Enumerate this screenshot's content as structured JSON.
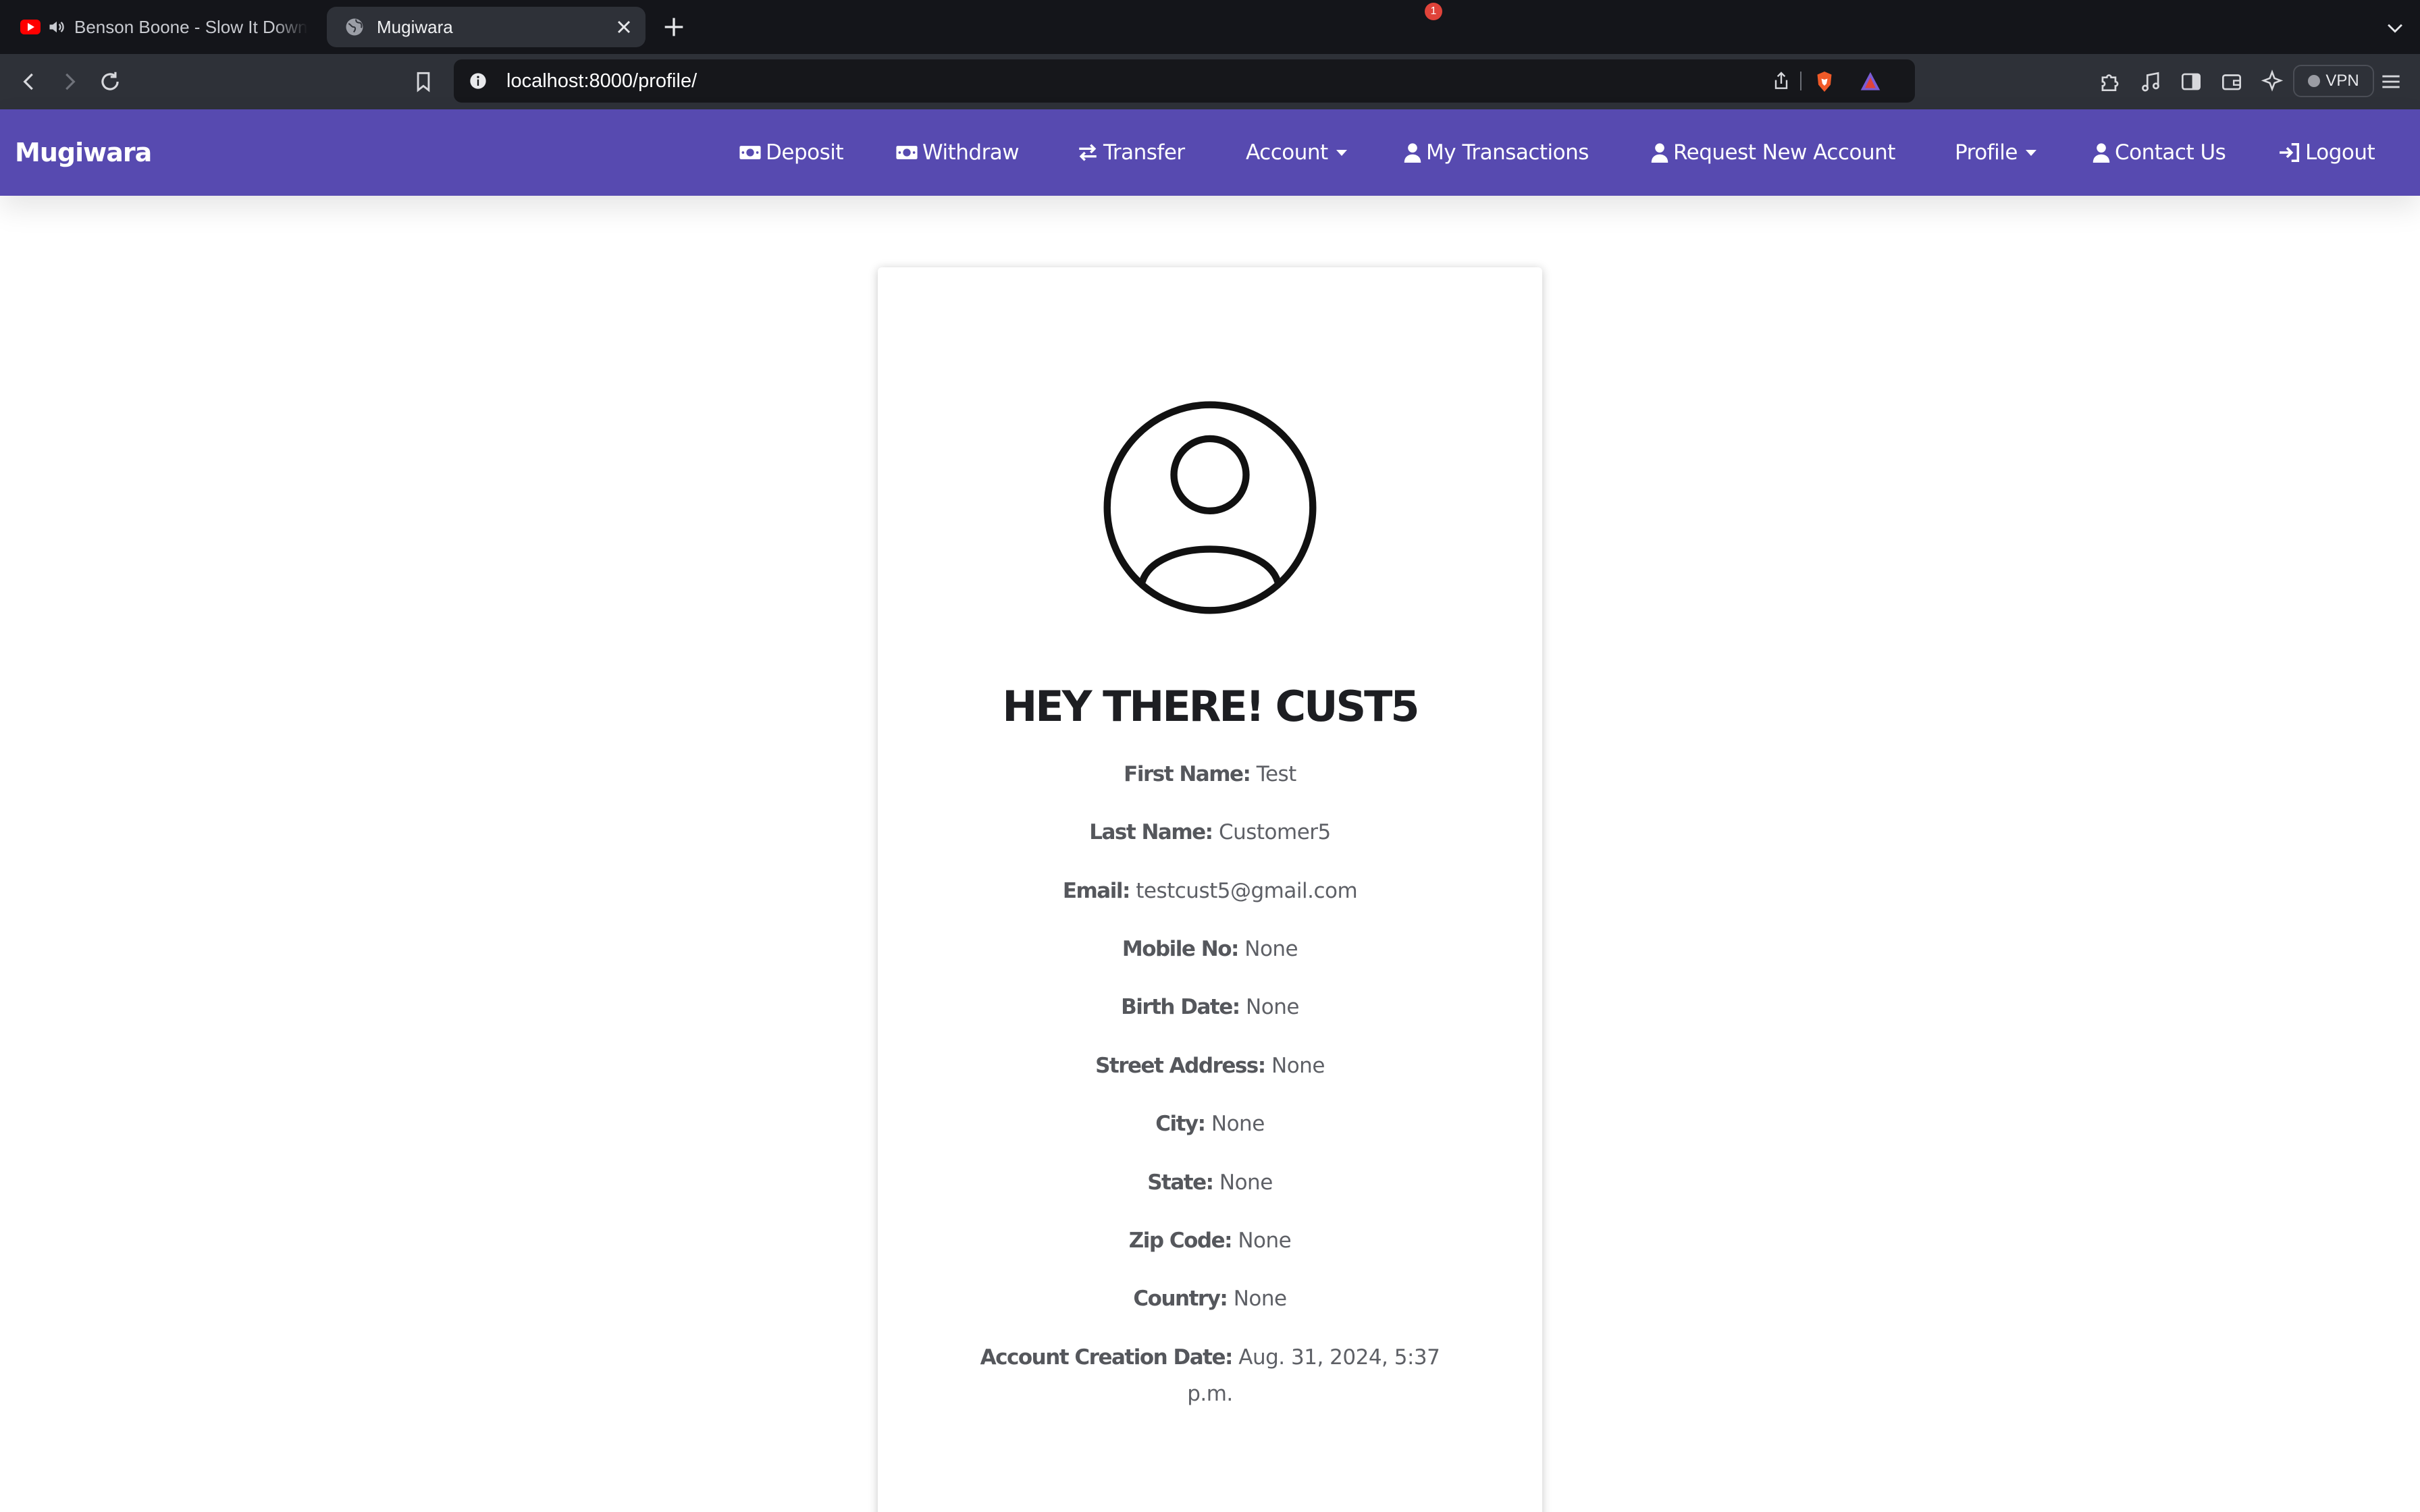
{
  "browser": {
    "tabs": [
      {
        "title": "Benson Boone - Slow It Down"
      },
      {
        "title": "Mugiwara"
      }
    ],
    "url": "localhost:8000/profile/",
    "rewards_badge": "1",
    "vpn_label": "VPN"
  },
  "navbar": {
    "brand": "Mugiwara",
    "items": [
      {
        "label": "Deposit",
        "icon": "money-bill-icon"
      },
      {
        "label": "Withdraw",
        "icon": "money-bill-icon"
      },
      {
        "label": "Transfer",
        "icon": "exchange-arrows-icon"
      },
      {
        "label": "Account",
        "dropdown": true
      },
      {
        "label": "My Transactions",
        "icon": "user-icon"
      },
      {
        "label": "Request New Account",
        "icon": "user-icon"
      },
      {
        "label": "Profile",
        "dropdown": true
      },
      {
        "label": "Contact Us",
        "icon": "user-icon"
      },
      {
        "label": "Logout",
        "icon": "sign-in-icon"
      }
    ]
  },
  "profile": {
    "greeting": "HEY THERE! CUST5",
    "fields": [
      {
        "label": "First Name:",
        "value": "Test"
      },
      {
        "label": "Last Name:",
        "value": "Customer5"
      },
      {
        "label": "Email:",
        "value": "testcust5@gmail.com"
      },
      {
        "label": "Mobile No:",
        "value": "None"
      },
      {
        "label": "Birth Date:",
        "value": "None"
      },
      {
        "label": "Street Address:",
        "value": "None"
      },
      {
        "label": "City:",
        "value": "None"
      },
      {
        "label": "State:",
        "value": "None"
      },
      {
        "label": "Zip Code:",
        "value": "None"
      },
      {
        "label": "Country:",
        "value": "None"
      },
      {
        "label": "Account Creation Date:",
        "value": "Aug. 31, 2024, 5:37 p.m."
      }
    ]
  },
  "colors": {
    "navbar_bg": "#574ab0",
    "chrome_bg": "#14151a",
    "toolbar_bg": "#2e3138"
  }
}
